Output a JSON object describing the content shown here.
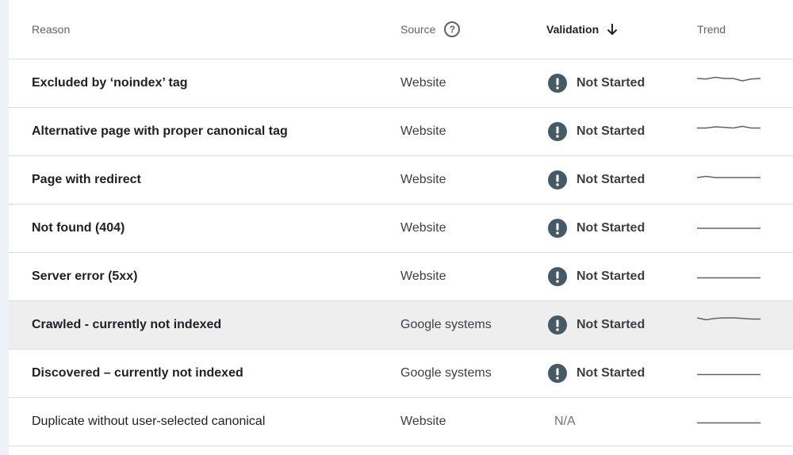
{
  "header": {
    "reason": "Reason",
    "source": "Source",
    "source_help_icon": "question-circle-icon",
    "validation": "Validation",
    "validation_sort_icon": "arrow-down-icon",
    "trend": "Trend"
  },
  "status_colors": {
    "warning_icon_bg": "#455a64",
    "sparkline": "#5f6368",
    "highlight_row": "#eeeeee"
  },
  "rows": [
    {
      "reason": "Excluded by ‘noindex’ tag",
      "source": "Website",
      "validation": "Not Started",
      "icon": "exclamation-circle-icon",
      "trend": [
        0.3,
        0.32,
        0.25,
        0.3,
        0.3,
        0.4,
        0.32,
        0.3
      ]
    },
    {
      "reason": "Alternative page with proper canonical tag",
      "source": "Website",
      "validation": "Not Started",
      "icon": "exclamation-circle-icon",
      "trend": [
        0.35,
        0.35,
        0.3,
        0.32,
        0.35,
        0.28,
        0.35,
        0.35
      ]
    },
    {
      "reason": "Page with redirect",
      "source": "Website",
      "validation": "Not Started",
      "icon": "exclamation-circle-icon",
      "trend": [
        0.4,
        0.35,
        0.4,
        0.4,
        0.4,
        0.4,
        0.4,
        0.4
      ]
    },
    {
      "reason": "Not found (404)",
      "source": "Website",
      "validation": "Not Started",
      "icon": "exclamation-circle-icon",
      "trend": [
        0.5,
        0.5,
        0.5,
        0.5,
        0.5,
        0.5,
        0.5,
        0.5
      ]
    },
    {
      "reason": "Server error (5xx)",
      "source": "Website",
      "validation": "Not Started",
      "icon": "exclamation-circle-icon",
      "trend": [
        0.55,
        0.55,
        0.55,
        0.55,
        0.55,
        0.55,
        0.55,
        0.55
      ]
    },
    {
      "reason": "Crawled - currently not indexed",
      "source": "Google systems",
      "validation": "Not Started",
      "icon": "exclamation-circle-icon",
      "trend": [
        0.2,
        0.28,
        0.22,
        0.2,
        0.2,
        0.22,
        0.25,
        0.25
      ],
      "highlighted": true
    },
    {
      "reason": "Discovered – currently not indexed",
      "source": "Google systems",
      "validation": "Not Started",
      "icon": "exclamation-circle-icon",
      "trend": [
        0.55,
        0.55,
        0.55,
        0.55,
        0.55,
        0.55,
        0.55,
        0.55
      ]
    },
    {
      "reason": "Duplicate without user-selected canonical",
      "source": "Website",
      "validation": "N/A",
      "icon": "",
      "trend": [
        0.55,
        0.55,
        0.55,
        0.55,
        0.55,
        0.55,
        0.55,
        0.55
      ]
    }
  ]
}
